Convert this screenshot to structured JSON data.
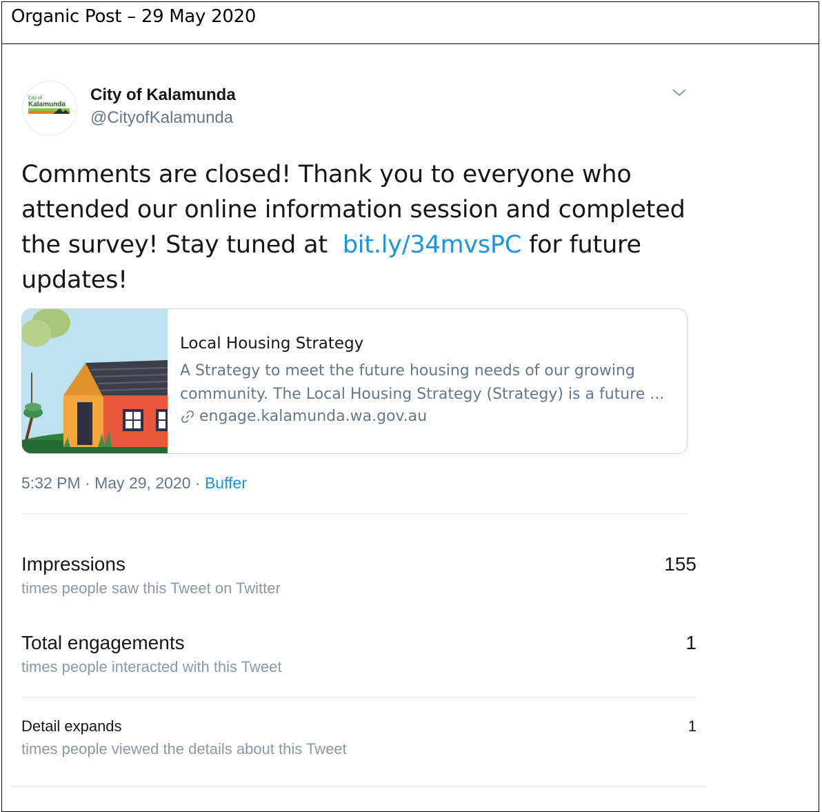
{
  "header": {
    "title": "Organic Post – 29 May 2020"
  },
  "tweet": {
    "author_name": "City of Kalamunda",
    "author_handle": "@CityofKalamunda",
    "avatar_text_small": "City of",
    "avatar_text_main": "Kalamunda",
    "text_line1": "Comments are closed! Thank you to everyone who",
    "text_line2": "attended our online information session and completed",
    "text_line3_before": "the survey! Stay tuned at ",
    "link": "bit.ly/34mvsPC",
    "text_line3_after": " for future",
    "text_line4": "updates!",
    "card": {
      "title": "Local Housing Strategy",
      "desc_line1": "A Strategy to meet the future housing needs of our growing",
      "desc_line2": "community. The Local Housing Strategy (Strategy) is a future ...",
      "domain": "engage.kalamunda.wa.gov.au",
      "icon": "link-icon"
    },
    "time": "5:32 PM",
    "date": "May 29, 2020",
    "separator": "·",
    "source": "Buffer",
    "menu_icon": "chevron-down-icon"
  },
  "stats": [
    {
      "label": "Impressions",
      "sub": "times people saw this Tweet on Twitter",
      "value": "155"
    },
    {
      "label": "Total engagements",
      "sub": "times people interacted with this Tweet",
      "value": "1"
    },
    {
      "label": "Detail expands",
      "sub": "times people viewed the details about this Tweet",
      "value": "1"
    }
  ],
  "colors": {
    "link": "#1b95e0",
    "secondary": "#657786",
    "muted": "#8899a6",
    "text": "#14171a",
    "border": "#ccd6dd"
  }
}
